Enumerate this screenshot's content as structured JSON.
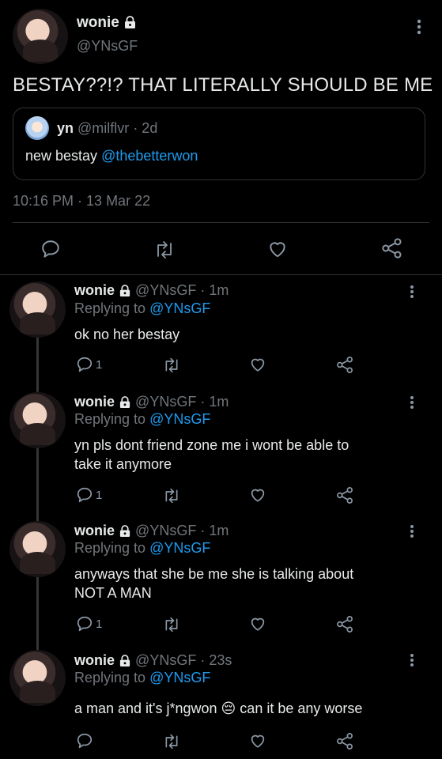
{
  "main_tweet": {
    "display_name": "wonie",
    "handle": "@YNsGF",
    "text": "BESTAY??!? THAT LITERALLY SHOULD BE ME",
    "timestamp": "10:16 PM · 13 Mar 22",
    "quote": {
      "display_name": "yn",
      "handle": "@milflvr",
      "age": "· 2d",
      "text_prefix": "new bestay",
      "mention": "@thebetterwon"
    }
  },
  "replies": [
    {
      "display_name": "wonie",
      "handle": "@YNsGF",
      "age": "· 1m",
      "replying_label": "Replying to",
      "replying_to": "@YNsGF",
      "text_lines": [
        "ok no her bestay"
      ],
      "reply_count": "1"
    },
    {
      "display_name": "wonie",
      "handle": "@YNsGF",
      "age": "· 1m",
      "replying_label": "Replying to",
      "replying_to": "@YNsGF",
      "text_lines": [
        "yn pls dont friend zone me i wont be able to",
        "take it anymore"
      ],
      "reply_count": "1"
    },
    {
      "display_name": "wonie",
      "handle": "@YNsGF",
      "age": "· 1m",
      "replying_label": "Replying to",
      "replying_to": "@YNsGF",
      "text_lines": [
        "anyways that she be me she is talking about",
        "NOT A MAN"
      ],
      "reply_count": "1"
    },
    {
      "display_name": "wonie",
      "handle": "@YNsGF",
      "age": "· 23s",
      "replying_label": "Replying to",
      "replying_to": "@YNsGF",
      "text_lines": [
        "a man and it's j*ngwon 😔 can it be any worse"
      ],
      "reply_count": ""
    }
  ],
  "icons": {
    "reply": "reply-icon",
    "retweet": "retweet-icon",
    "like": "heart-icon",
    "share": "share-icon",
    "more": "more-icon",
    "lock": "lock-icon"
  },
  "colors": {
    "background": "#000000",
    "text": "#e7e9ea",
    "muted": "#71767b",
    "link": "#1d9bf0",
    "divider": "#2f3336"
  }
}
